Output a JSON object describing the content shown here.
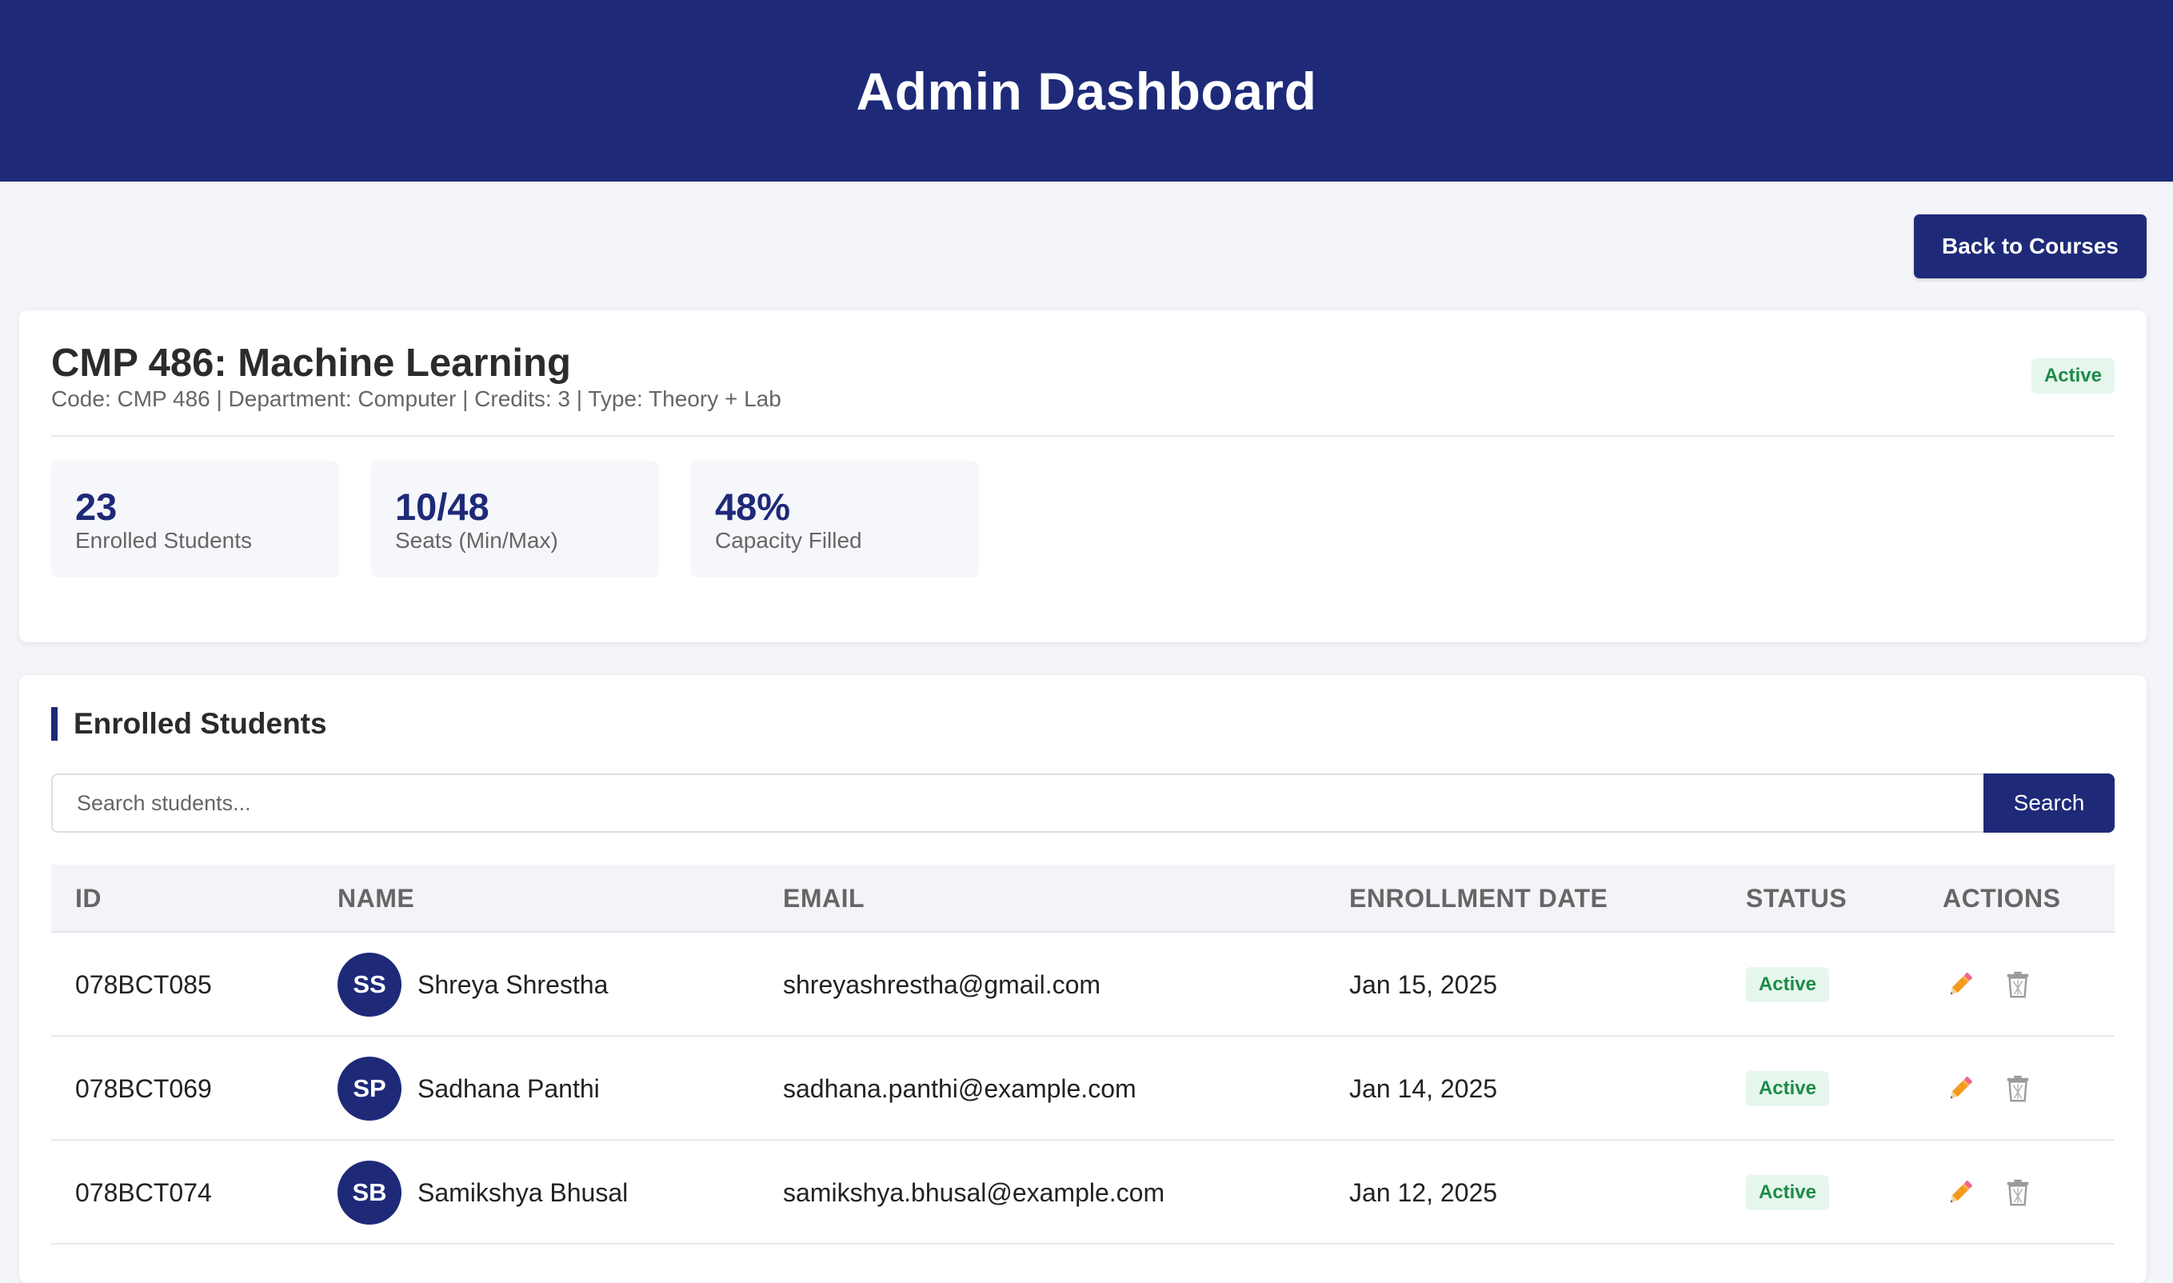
{
  "header": {
    "title": "Admin Dashboard"
  },
  "toolbar": {
    "back_label": "Back to Courses"
  },
  "course": {
    "title": "CMP 486: Machine Learning",
    "meta": "Code: CMP 486 | Department: Computer | Credits: 3 | Type: Theory + Lab",
    "status": "Active",
    "stats": [
      {
        "value": "23",
        "label": "Enrolled Students"
      },
      {
        "value": "10/48",
        "label": "Seats (Min/Max)"
      },
      {
        "value": "48%",
        "label": "Capacity Filled"
      }
    ]
  },
  "students": {
    "section_title": "Enrolled Students",
    "search_placeholder": "Search students...",
    "search_label": "Search",
    "columns": [
      "ID",
      "NAME",
      "EMAIL",
      "ENROLLMENT DATE",
      "STATUS",
      "ACTIONS"
    ],
    "rows": [
      {
        "id": "078BCT085",
        "initials": "SS",
        "name": "Shreya Shrestha",
        "email": "shreyashrestha@gmail.com",
        "date": "Jan 15, 2025",
        "status": "Active"
      },
      {
        "id": "078BCT069",
        "initials": "SP",
        "name": "Sadhana Panthi",
        "email": "sadhana.panthi@example.com",
        "date": "Jan 14, 2025",
        "status": "Active"
      },
      {
        "id": "078BCT074",
        "initials": "SB",
        "name": "Samikshya Bhusal",
        "email": "samikshya.bhusal@example.com",
        "date": "Jan 12, 2025",
        "status": "Active"
      }
    ],
    "icons": {
      "edit": "pencil-icon",
      "delete": "trash-icon"
    }
  },
  "colors": {
    "primary": "#1e2a78",
    "badge_bg": "#e6f6ec",
    "badge_text": "#1e8a4a",
    "page_bg": "#f4f5f9"
  }
}
